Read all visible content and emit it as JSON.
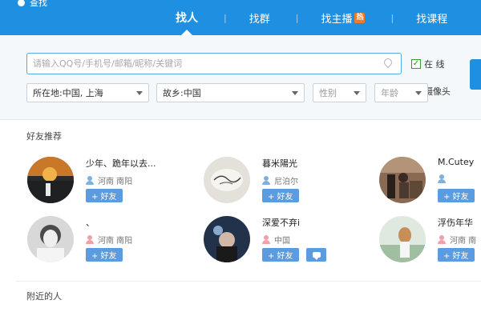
{
  "header": {
    "app_title": "查找",
    "tabs": [
      {
        "label": "找人",
        "active": true
      },
      {
        "label": "找群"
      },
      {
        "label": "找主播",
        "badge": "热"
      },
      {
        "label": "找课程"
      }
    ],
    "separator": "|"
  },
  "search": {
    "placeholder": "请输入QQ号/手机号/邮箱/昵称/关键词",
    "online_label": "在 线",
    "online_checked": true,
    "camera_label": "摄像头",
    "camera_checked": false
  },
  "filters": {
    "location": "所在地:中国, 上海",
    "hometown": "故乡:中国",
    "gender": "性别",
    "age": "年龄"
  },
  "recommend": {
    "title": "好友推荐",
    "add_label": "+ 好友",
    "people": [
      {
        "nick": "少年、跪年以去...",
        "location": "河南 南阳",
        "gender": "male"
      },
      {
        "nick": "暮米陽光",
        "location": "尼泊尔",
        "gender": "male"
      },
      {
        "nick": "M.Cutey",
        "location": "",
        "gender": "male"
      },
      {
        "nick": "、",
        "location": "河南 南阳",
        "gender": "female"
      },
      {
        "nick": "深爱不弃i",
        "location": "中国",
        "gender": "female",
        "has_message": true
      },
      {
        "nick": "浮伤年华",
        "location": "河南 南",
        "gender": "female"
      }
    ]
  },
  "nearby": {
    "title": "附近的人"
  },
  "colors": {
    "header_blue": "#1e8fe1",
    "button_blue": "#5b9be0",
    "hot_badge": "#f07a2a"
  }
}
